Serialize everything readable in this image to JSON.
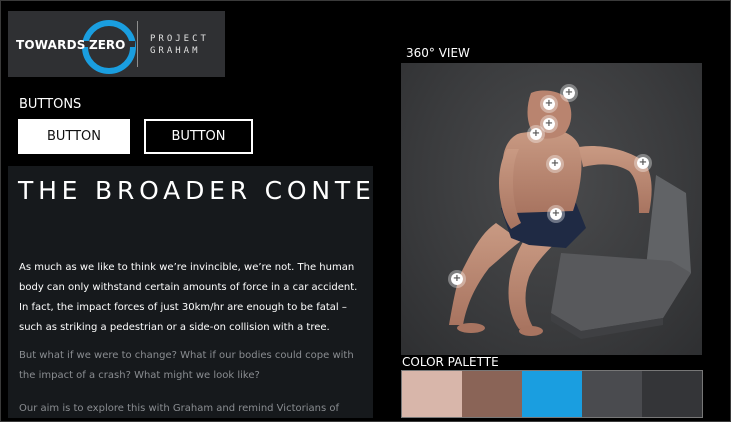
{
  "logo": {
    "left_word": "TOWARDS",
    "ring_word": "ZERO",
    "project_line1": "PROJECT",
    "project_line2": "GRAHAM"
  },
  "buttons_section": {
    "title": "BUTTONS",
    "primary_label": "BUTTON",
    "secondary_label": "BUTTON"
  },
  "article": {
    "heading": "THE BROADER CONTEXT",
    "paragraph1": "As much as we like to think we’re invincible, we’re not. The human body can only withstand certain amounts of force in a car accident. In fact, the impact forces of just 30km/hr are enough to be fatal – such as striking a pedestrian or a side-on collision with a tree.",
    "paragraph2": "But what if we were to change? What if our bodies could cope with the impact of a crash? What might we look like?",
    "paragraph3": "Our aim is to explore this with Graham and remind Victorians of how"
  },
  "view": {
    "title": "360° VIEW"
  },
  "palette": {
    "title": "COLOR PALETTE",
    "colors": [
      "#d8b6aa",
      "#8a6457",
      "#1a9ee0",
      "#4a4b4f",
      "#343538"
    ]
  }
}
